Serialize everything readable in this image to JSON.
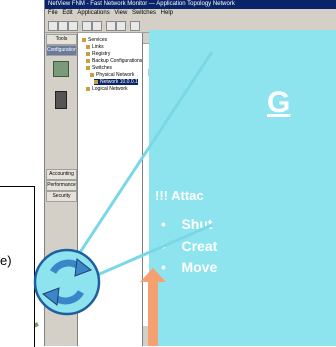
{
  "window": {
    "title": "NetView FNM - Fast Network Monitor — Application Topology Network",
    "menu": [
      "File",
      "Edit",
      "Applications",
      "View",
      "Switches",
      "Help"
    ]
  },
  "leftnav": {
    "top_label": "Tools",
    "selected_label": "Configuration",
    "bottom_items": [
      "Accounting",
      "Performance",
      "Security"
    ]
  },
  "tree": {
    "items": [
      "Services",
      "Links",
      "Registry",
      "Backup Configurations",
      "Switches",
      "Physical Network",
      "Network 10.0.0.1",
      "Logical Network"
    ]
  },
  "callout": {
    "heading_fragment": "G",
    "attack_line": "!!! Attac",
    "bullets": [
      "Shut",
      "Creat",
      "Move"
    ]
  },
  "side": {
    "label_fragment": "e)"
  },
  "colors": {
    "overlay": "#8ee4ee",
    "arrow": "#f4a070",
    "refresh": "#3a86c8"
  }
}
